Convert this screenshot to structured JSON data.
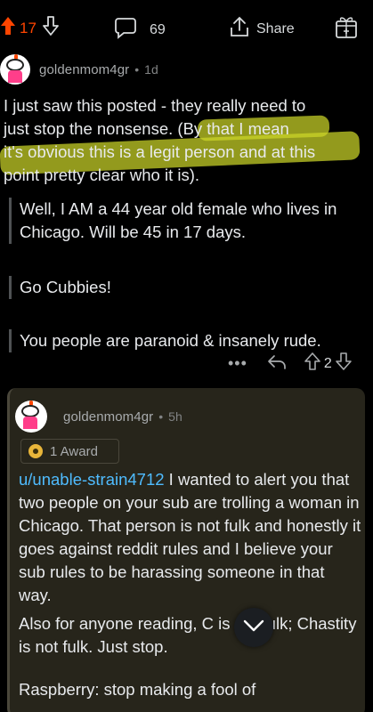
{
  "topbar": {
    "upvote_icon": "upvote-arrow-filled",
    "vote_count": "17",
    "downvote_icon": "downvote-arrow",
    "comment_icon": "chat-bubble",
    "comment_count": "69",
    "share_icon": "share-arrow-up",
    "share_label": "Share",
    "award_icon": "award-gift-plus"
  },
  "comment": {
    "author": "goldenmom4gr",
    "separator": "•",
    "age": "1d",
    "body_lines": [
      "I just saw this posted - they really need to",
      "just stop the nonsense.  (By that I mean",
      "it's obvious this is a legit person and at this",
      "point pretty clear who it is)."
    ],
    "quotes": [
      "Well, I AM a 44 year old female who lives in Chicago. Will be 45 in 17 days.",
      "Go Cubbies!",
      "You people are paranoid & insanely rude."
    ],
    "actions": {
      "more": "•••",
      "score": "2"
    },
    "highlight_color": "#ccd628"
  },
  "reply": {
    "author": "goldenmom4gr",
    "separator": "•",
    "age": "5h",
    "award_label": "1 Award",
    "mention": "u/unable-strain4712",
    "para1_rest": " I wanted to alert you that two people on your sub are trolling a woman in Chicago.  That person is not fulk and honestly it goes against reddit rules and I believe your sub rules to be harassing someone in that way.",
    "para2": "Also for anyone reading, C          is not fulk; Chastity is not fulk.  Just stop.",
    "para3": "Raspberry: stop making a fool of"
  },
  "colors": {
    "background": "#000000",
    "accent_orange": "#ff4500",
    "mention_blue": "#4fbcff",
    "reply_bg": "#27251b"
  }
}
